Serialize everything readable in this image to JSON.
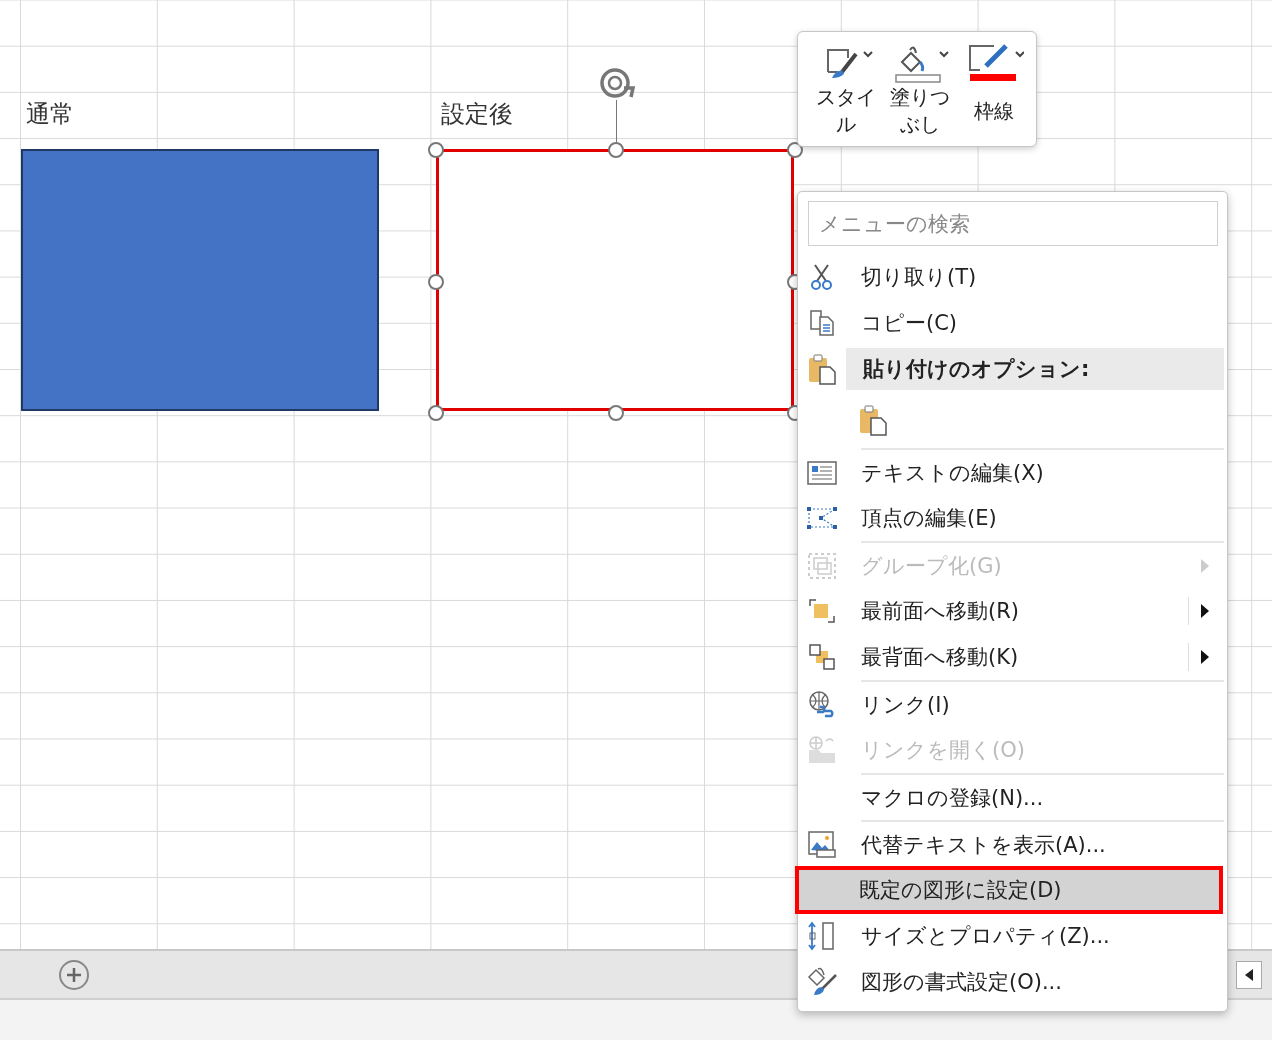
{
  "shapes": [
    {
      "label": "通常",
      "kind": "filled",
      "color": "#4472c4",
      "selected": false
    },
    {
      "label": "設定後",
      "kind": "outline",
      "color": "#e00000",
      "selected": true
    }
  ],
  "mini_toolbar": {
    "buttons": [
      {
        "label": "スタイル"
      },
      {
        "label": "塗りつぶし"
      },
      {
        "label": "枠線"
      }
    ]
  },
  "context_menu": {
    "search": {
      "placeholder": "メニューの検索"
    },
    "items": [
      {
        "kind": "item",
        "label": "切り取り(T)",
        "disabled": false,
        "submenu": false,
        "separator_before": false,
        "selected": false,
        "outlined": false
      },
      {
        "kind": "item",
        "label": "コピー(C)",
        "disabled": false,
        "submenu": false,
        "separator_before": false,
        "selected": false,
        "outlined": false
      },
      {
        "kind": "header",
        "label": "貼り付けのオプション:"
      },
      {
        "kind": "paste-buttons"
      },
      {
        "kind": "item",
        "label": "テキストの編集(X)",
        "disabled": false,
        "submenu": false,
        "separator_before": true,
        "selected": false,
        "outlined": false
      },
      {
        "kind": "item",
        "label": "頂点の編集(E)",
        "disabled": false,
        "submenu": false,
        "separator_before": false,
        "selected": false,
        "outlined": false
      },
      {
        "kind": "item",
        "label": "グループ化(G)",
        "disabled": true,
        "submenu": true,
        "separator_before": true,
        "selected": false,
        "outlined": false
      },
      {
        "kind": "item",
        "label": "最前面へ移動(R)",
        "disabled": false,
        "submenu": true,
        "separator_before": false,
        "selected": false,
        "outlined": false
      },
      {
        "kind": "item",
        "label": "最背面へ移動(K)",
        "disabled": false,
        "submenu": true,
        "separator_before": false,
        "selected": false,
        "outlined": false
      },
      {
        "kind": "item",
        "label": "リンク(I)",
        "disabled": false,
        "submenu": false,
        "separator_before": true,
        "selected": false,
        "outlined": false
      },
      {
        "kind": "item",
        "label": "リンクを開く(O)",
        "disabled": true,
        "submenu": false,
        "separator_before": false,
        "selected": false,
        "outlined": false
      },
      {
        "kind": "item",
        "label": "マクロの登録(N)...",
        "disabled": false,
        "submenu": false,
        "separator_before": true,
        "selected": false,
        "outlined": false
      },
      {
        "kind": "item",
        "label": "代替テキストを表示(A)...",
        "disabled": false,
        "submenu": false,
        "separator_before": true,
        "selected": false,
        "outlined": false
      },
      {
        "kind": "item",
        "label": "既定の図形に設定(D)",
        "disabled": false,
        "submenu": false,
        "separator_before": false,
        "selected": true,
        "outlined": true
      },
      {
        "kind": "item",
        "label": "サイズとプロパティ(Z)...",
        "disabled": false,
        "submenu": false,
        "separator_before": false,
        "selected": false,
        "outlined": false
      },
      {
        "kind": "item",
        "label": "図形の書式設定(O)...",
        "disabled": false,
        "submenu": false,
        "separator_before": false,
        "selected": false,
        "outlined": false
      }
    ]
  }
}
